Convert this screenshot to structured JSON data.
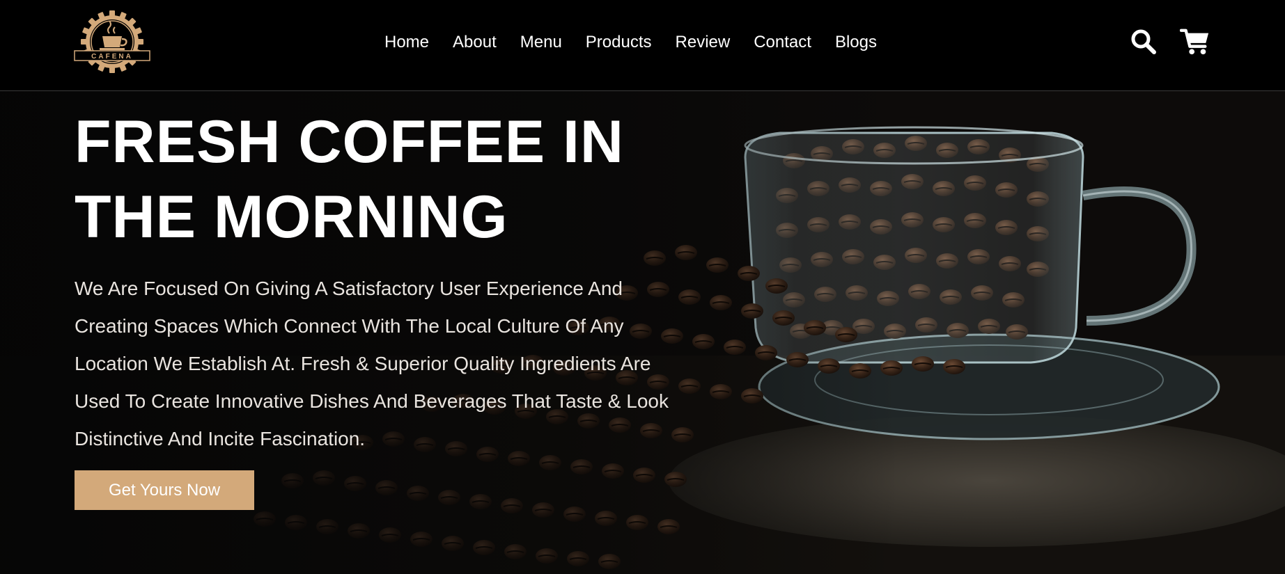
{
  "brand": {
    "logo_text": "CAFENA",
    "accent_color": "#d3a97a"
  },
  "nav": {
    "items": [
      {
        "label": "Home"
      },
      {
        "label": "About"
      },
      {
        "label": "Menu"
      },
      {
        "label": "Products"
      },
      {
        "label": "Review"
      },
      {
        "label": "Contact"
      },
      {
        "label": "Blogs"
      }
    ]
  },
  "header_icons": {
    "search": "search-icon",
    "cart": "cart-icon"
  },
  "hero": {
    "title_line1": "FRESH COFFEE IN",
    "title_line2": "THE MORNING",
    "description": "We Are Focused On Giving A Satisfactory User Experience And Creating Spaces Which Connect With The Local Culture Of Any Location We Establish At. Fresh & Superior Quality Ingredients Are Used To Create Innovative Dishes And Beverages That Taste & Look Distinctive And Incite Fascination.",
    "cta_label": "Get Yours Now",
    "image": "coffee-beans-glass-cup"
  }
}
